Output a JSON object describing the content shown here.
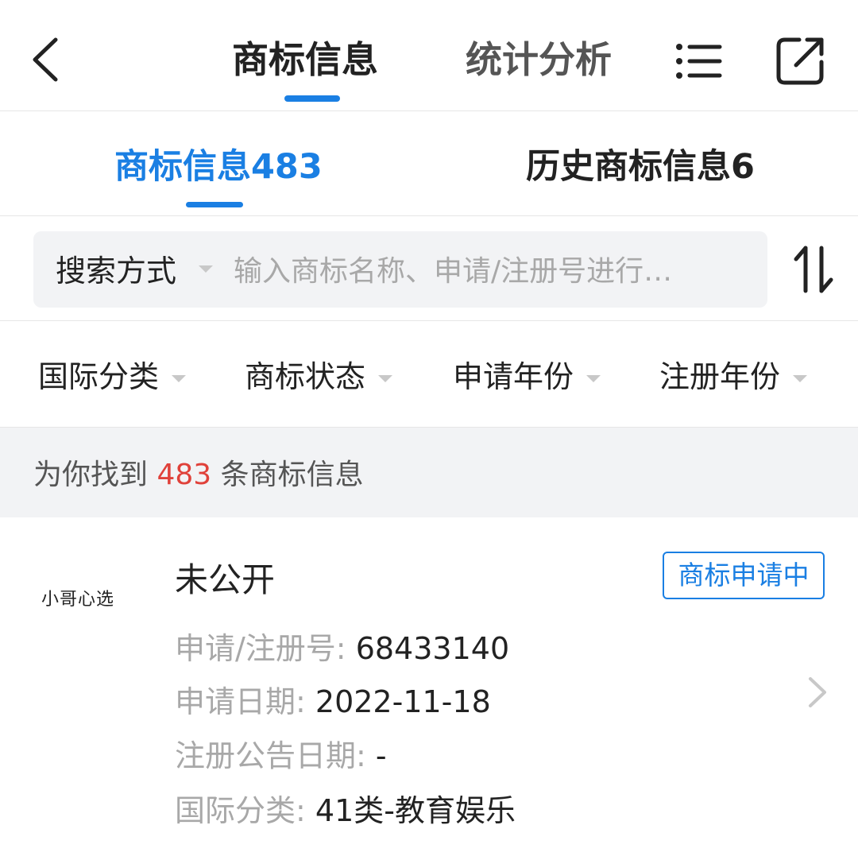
{
  "nav": {
    "tabs": [
      {
        "label": "商标信息",
        "active": true
      },
      {
        "label": "统计分析",
        "active": false
      }
    ],
    "icons": [
      "back-icon",
      "list-icon",
      "share-icon"
    ]
  },
  "subtabs": [
    {
      "label": "商标信息483",
      "active": true
    },
    {
      "label": "历史商标信息6",
      "active": false
    }
  ],
  "search": {
    "mode_label": "搜索方式",
    "placeholder": "输入商标名称、申请/注册号进行…",
    "value": ""
  },
  "filters": [
    {
      "label": "国际分类"
    },
    {
      "label": "商标状态"
    },
    {
      "label": "申请年份"
    },
    {
      "label": "注册年份"
    }
  ],
  "summary": {
    "prefix": "为你找到",
    "count": "483",
    "suffix": "条商标信息"
  },
  "results": [
    {
      "image_text": "小哥心选",
      "name": "未公开",
      "status": "商标申请中",
      "fields": [
        {
          "label": "申请/注册号:",
          "value": "68433140"
        },
        {
          "label": "申请日期:",
          "value": "2022-11-18"
        },
        {
          "label": "注册公告日期:",
          "value": "-"
        },
        {
          "label": "国际分类:",
          "value": "41类-教育娱乐"
        }
      ]
    }
  ],
  "colors": {
    "accent": "#1a7fe3",
    "count_highlight": "#e0413a",
    "label_gray": "#a8a8a8",
    "band_gray": "#f2f3f5"
  }
}
